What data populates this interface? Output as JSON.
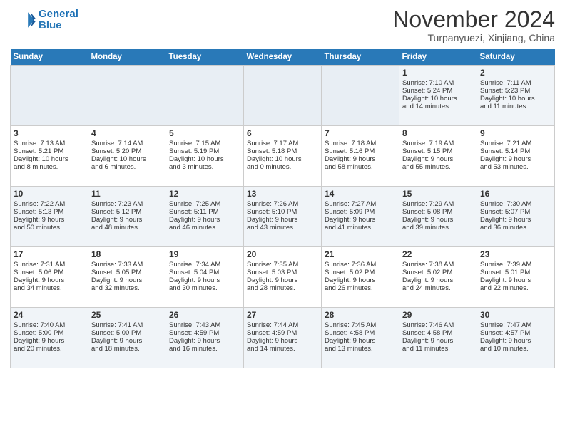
{
  "header": {
    "logo_line1": "General",
    "logo_line2": "Blue",
    "month": "November 2024",
    "location": "Turpanyuezi, Xinjiang, China"
  },
  "weekdays": [
    "Sunday",
    "Monday",
    "Tuesday",
    "Wednesday",
    "Thursday",
    "Friday",
    "Saturday"
  ],
  "weeks": [
    [
      {
        "day": "",
        "text": ""
      },
      {
        "day": "",
        "text": ""
      },
      {
        "day": "",
        "text": ""
      },
      {
        "day": "",
        "text": ""
      },
      {
        "day": "",
        "text": ""
      },
      {
        "day": "1",
        "text": "Sunrise: 7:10 AM\nSunset: 5:24 PM\nDaylight: 10 hours\nand 14 minutes."
      },
      {
        "day": "2",
        "text": "Sunrise: 7:11 AM\nSunset: 5:23 PM\nDaylight: 10 hours\nand 11 minutes."
      }
    ],
    [
      {
        "day": "3",
        "text": "Sunrise: 7:13 AM\nSunset: 5:21 PM\nDaylight: 10 hours\nand 8 minutes."
      },
      {
        "day": "4",
        "text": "Sunrise: 7:14 AM\nSunset: 5:20 PM\nDaylight: 10 hours\nand 6 minutes."
      },
      {
        "day": "5",
        "text": "Sunrise: 7:15 AM\nSunset: 5:19 PM\nDaylight: 10 hours\nand 3 minutes."
      },
      {
        "day": "6",
        "text": "Sunrise: 7:17 AM\nSunset: 5:18 PM\nDaylight: 10 hours\nand 0 minutes."
      },
      {
        "day": "7",
        "text": "Sunrise: 7:18 AM\nSunset: 5:16 PM\nDaylight: 9 hours\nand 58 minutes."
      },
      {
        "day": "8",
        "text": "Sunrise: 7:19 AM\nSunset: 5:15 PM\nDaylight: 9 hours\nand 55 minutes."
      },
      {
        "day": "9",
        "text": "Sunrise: 7:21 AM\nSunset: 5:14 PM\nDaylight: 9 hours\nand 53 minutes."
      }
    ],
    [
      {
        "day": "10",
        "text": "Sunrise: 7:22 AM\nSunset: 5:13 PM\nDaylight: 9 hours\nand 50 minutes."
      },
      {
        "day": "11",
        "text": "Sunrise: 7:23 AM\nSunset: 5:12 PM\nDaylight: 9 hours\nand 48 minutes."
      },
      {
        "day": "12",
        "text": "Sunrise: 7:25 AM\nSunset: 5:11 PM\nDaylight: 9 hours\nand 46 minutes."
      },
      {
        "day": "13",
        "text": "Sunrise: 7:26 AM\nSunset: 5:10 PM\nDaylight: 9 hours\nand 43 minutes."
      },
      {
        "day": "14",
        "text": "Sunrise: 7:27 AM\nSunset: 5:09 PM\nDaylight: 9 hours\nand 41 minutes."
      },
      {
        "day": "15",
        "text": "Sunrise: 7:29 AM\nSunset: 5:08 PM\nDaylight: 9 hours\nand 39 minutes."
      },
      {
        "day": "16",
        "text": "Sunrise: 7:30 AM\nSunset: 5:07 PM\nDaylight: 9 hours\nand 36 minutes."
      }
    ],
    [
      {
        "day": "17",
        "text": "Sunrise: 7:31 AM\nSunset: 5:06 PM\nDaylight: 9 hours\nand 34 minutes."
      },
      {
        "day": "18",
        "text": "Sunrise: 7:33 AM\nSunset: 5:05 PM\nDaylight: 9 hours\nand 32 minutes."
      },
      {
        "day": "19",
        "text": "Sunrise: 7:34 AM\nSunset: 5:04 PM\nDaylight: 9 hours\nand 30 minutes."
      },
      {
        "day": "20",
        "text": "Sunrise: 7:35 AM\nSunset: 5:03 PM\nDaylight: 9 hours\nand 28 minutes."
      },
      {
        "day": "21",
        "text": "Sunrise: 7:36 AM\nSunset: 5:02 PM\nDaylight: 9 hours\nand 26 minutes."
      },
      {
        "day": "22",
        "text": "Sunrise: 7:38 AM\nSunset: 5:02 PM\nDaylight: 9 hours\nand 24 minutes."
      },
      {
        "day": "23",
        "text": "Sunrise: 7:39 AM\nSunset: 5:01 PM\nDaylight: 9 hours\nand 22 minutes."
      }
    ],
    [
      {
        "day": "24",
        "text": "Sunrise: 7:40 AM\nSunset: 5:00 PM\nDaylight: 9 hours\nand 20 minutes."
      },
      {
        "day": "25",
        "text": "Sunrise: 7:41 AM\nSunset: 5:00 PM\nDaylight: 9 hours\nand 18 minutes."
      },
      {
        "day": "26",
        "text": "Sunrise: 7:43 AM\nSunset: 4:59 PM\nDaylight: 9 hours\nand 16 minutes."
      },
      {
        "day": "27",
        "text": "Sunrise: 7:44 AM\nSunset: 4:59 PM\nDaylight: 9 hours\nand 14 minutes."
      },
      {
        "day": "28",
        "text": "Sunrise: 7:45 AM\nSunset: 4:58 PM\nDaylight: 9 hours\nand 13 minutes."
      },
      {
        "day": "29",
        "text": "Sunrise: 7:46 AM\nSunset: 4:58 PM\nDaylight: 9 hours\nand 11 minutes."
      },
      {
        "day": "30",
        "text": "Sunrise: 7:47 AM\nSunset: 4:57 PM\nDaylight: 9 hours\nand 10 minutes."
      }
    ]
  ]
}
